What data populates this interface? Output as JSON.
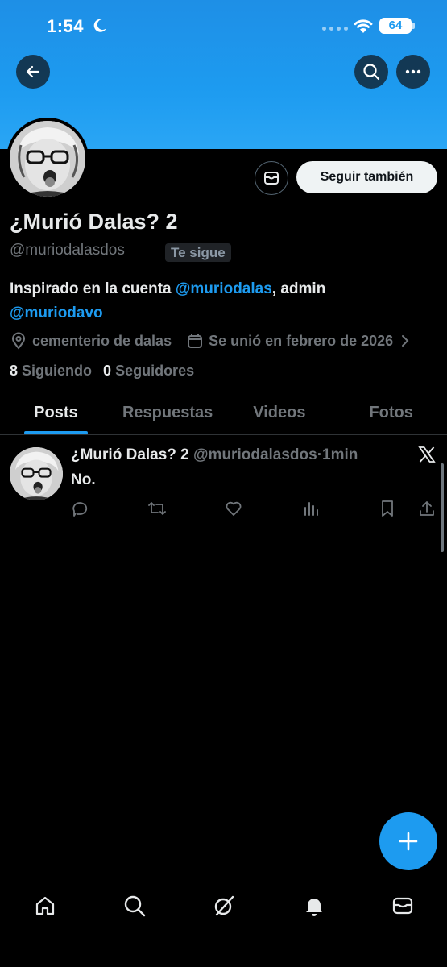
{
  "status_bar": {
    "time": "1:54",
    "battery": "64"
  },
  "header": {
    "back": "back-arrow-icon",
    "search": "search-icon",
    "more": "more-icon"
  },
  "profile": {
    "display_name": "¿Murió Dalas? 2",
    "handle": "@muriodalasdos",
    "follows_you": "Te sigue",
    "follow_button": "Seguir también",
    "bio_prefix": "Inspirado en la cuenta ",
    "bio_mention1": "@muriodalas",
    "bio_middle": ", admin",
    "bio_mention2": "@muriodavo",
    "location": "cementerio de dalas",
    "joined": "Se unió en febrero de 2026",
    "following_count": "8",
    "following_label": "Siguiendo",
    "followers_count": "0",
    "followers_label": "Seguidores"
  },
  "tabs": [
    "Posts",
    "Respuestas",
    "Videos",
    "Fotos"
  ],
  "post": {
    "name": "¿Murió Dalas? 2",
    "handle": "@muriodalasdos",
    "dot": "·",
    "time": "1min",
    "text": "No."
  },
  "colors": {
    "accent": "#1d9bf0",
    "background": "#000000",
    "muted": "#71767b"
  }
}
